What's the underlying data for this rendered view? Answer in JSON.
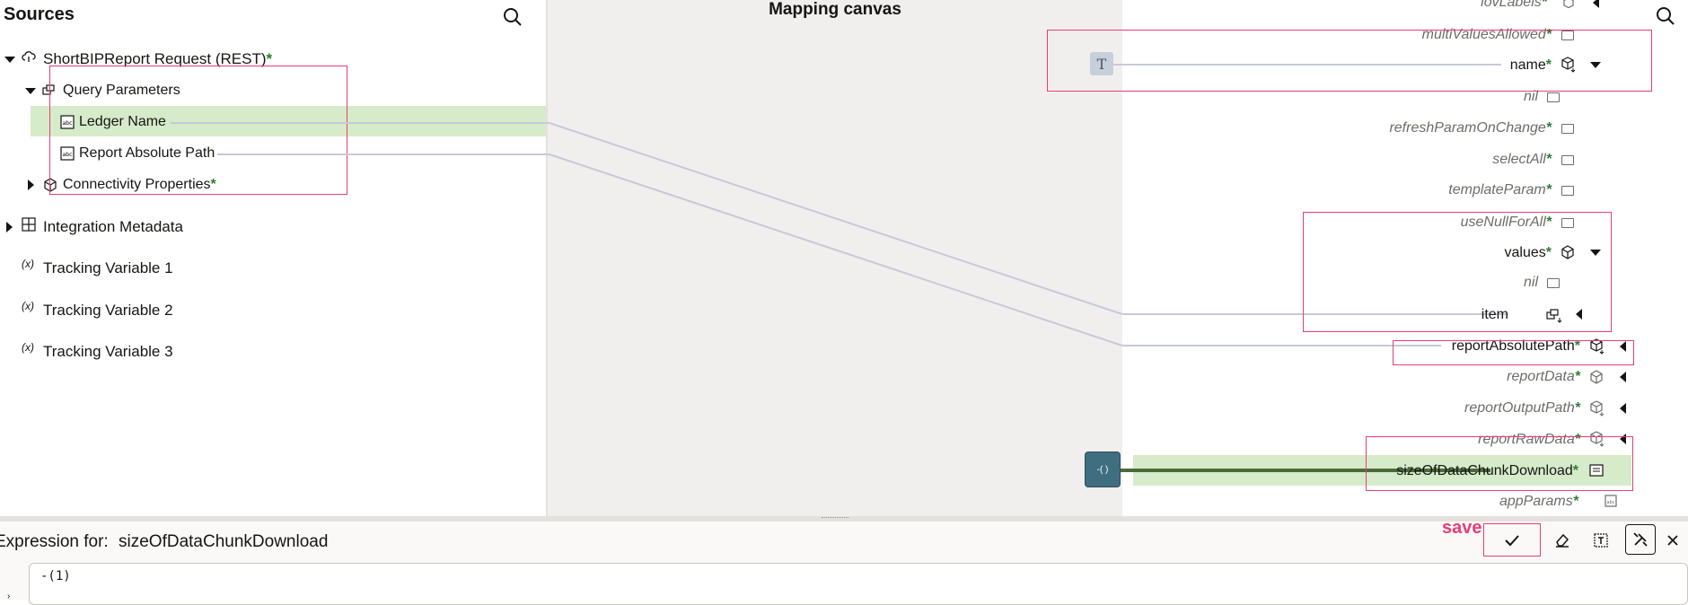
{
  "sources": {
    "title": "Sources",
    "root": {
      "label": "ShortBIPReport Request (REST)",
      "required": "*"
    },
    "query_parameters": {
      "label": "Query Parameters"
    },
    "params": [
      {
        "label": "Ledger Name"
      },
      {
        "label": "Report Absolute Path"
      }
    ],
    "connectivity": {
      "label": "Connectivity Properties",
      "required": "*"
    },
    "integration_metadata": {
      "label": "Integration Metadata"
    },
    "tracking_variables": [
      {
        "label": "Tracking Variable 1",
        "icon": "(x)"
      },
      {
        "label": "Tracking Variable 2",
        "icon": "(x)"
      },
      {
        "label": "Tracking Variable 3",
        "icon": "(x)"
      }
    ]
  },
  "canvas": {
    "title": "Mapping canvas",
    "text_node": "T",
    "expression_node": "-( )"
  },
  "target": {
    "items": [
      {
        "label": "lovLabels",
        "star": "*"
      },
      {
        "label": "multiValuesAllowed",
        "star": "*"
      },
      {
        "label": "name",
        "star": "*"
      },
      {
        "label": "nil",
        "star": ""
      },
      {
        "label": "refreshParamOnChange",
        "star": "*"
      },
      {
        "label": "selectAll",
        "star": "*"
      },
      {
        "label": "templateParam",
        "star": "*"
      },
      {
        "label": "useNullForAll",
        "star": "*"
      },
      {
        "label": "values",
        "star": "*"
      },
      {
        "label": "nil",
        "star": ""
      },
      {
        "label": "item",
        "star": ""
      },
      {
        "label": "reportAbsolutePath",
        "star": "*"
      },
      {
        "label": "reportData",
        "star": "*"
      },
      {
        "label": "reportOutputPath",
        "star": "*"
      },
      {
        "label": "reportRawData",
        "star": "*"
      },
      {
        "label": "sizeOfDataChunkDownload",
        "star": "*"
      },
      {
        "label": "appParams",
        "star": "*"
      }
    ]
  },
  "expression": {
    "label": "Expression for:",
    "target_name": "sizeOfDataChunkDownload",
    "value": "-(1)",
    "annotation": "save"
  },
  "colors": {
    "highlight_border": "#e83d77",
    "mapped_row": "#d6ebc9",
    "required_star": "#2e7d32",
    "function_node": "#3f6e80"
  }
}
